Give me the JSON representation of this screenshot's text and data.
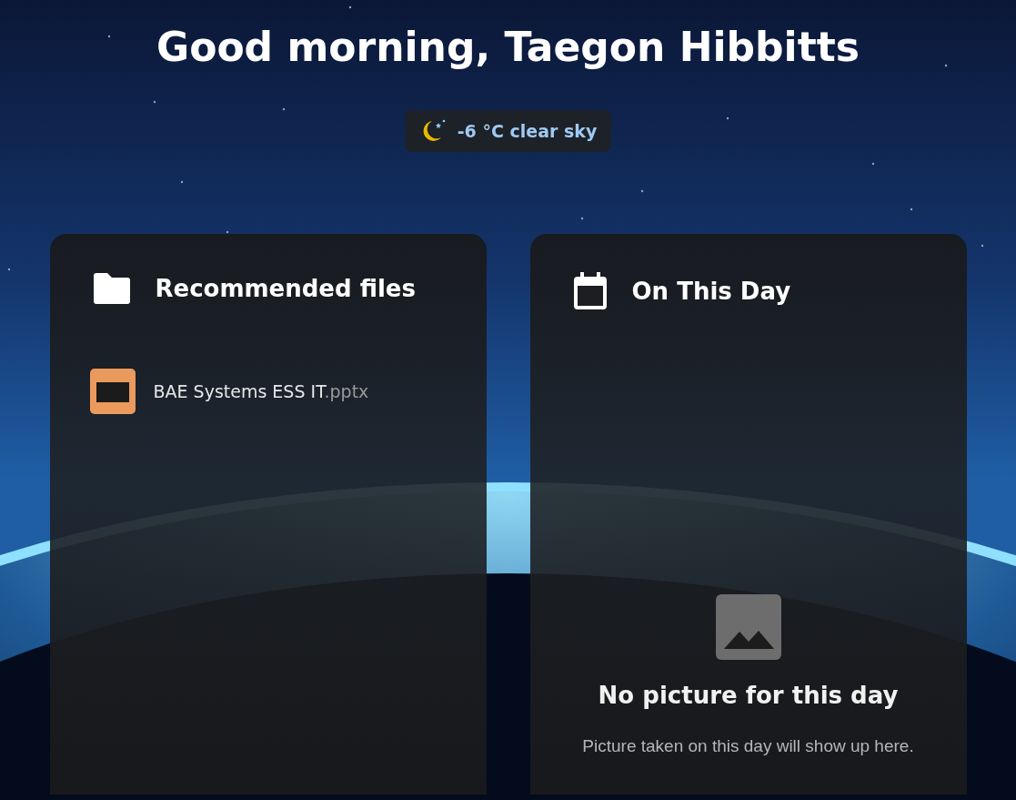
{
  "greeting": "Good morning, Taegon Hibbitts",
  "weather": {
    "text": "-6 °C clear sky"
  },
  "cards": [
    {
      "kind": "files",
      "title": "Recommended files",
      "files": [
        {
          "name": "BAE Systems ESS IT",
          "extension": ".pptx"
        }
      ]
    },
    {
      "kind": "on_this_day",
      "title": "On This Day",
      "empty_title": "No picture for this day",
      "empty_text": "Picture taken on this day will show up here."
    }
  ]
}
